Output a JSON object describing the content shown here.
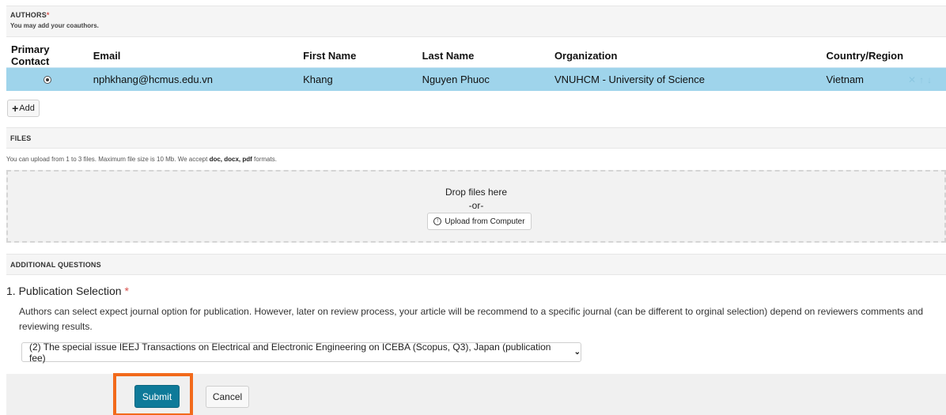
{
  "authors": {
    "title": "AUTHORS",
    "required_mark": "*",
    "subtitle": "You may add your coauthors.",
    "columns": [
      "Primary Contact",
      "Email",
      "First Name",
      "Last Name",
      "Organization",
      "Country/Region"
    ],
    "rows": [
      {
        "email": "nphkhang@hcmus.edu.vn",
        "first_name": "Khang",
        "last_name": "Nguyen Phuoc",
        "organization": "VNUHCM - University of Science",
        "country": "Vietnam"
      }
    ],
    "row_actions": {
      "delete": "✕",
      "up": "↑",
      "down": "↓"
    },
    "add_label": "Add"
  },
  "files": {
    "title": "FILES",
    "note_prefix": "You can upload from 1 to 3 files. Maximum file size is 10 Mb. We accept",
    "note_formats": "doc, docx, pdf",
    "note_suffix": "formats.",
    "drop_text": "Drop files here",
    "or_text": "-or-",
    "upload_label": "Upload from Computer"
  },
  "additional_questions": {
    "title": "ADDITIONAL QUESTIONS",
    "q1_title": "1. Publication Selection",
    "q1_required": "*",
    "q1_description": "Authors can select expect journal option for publication. However, later on review process, your article will be recommend to a specific journal (can be different to orginal selection) depend on reviewers comments and reviewing results.",
    "q1_selected": "(2) The special issue IEEJ Transactions on Electrical and Electronic Engineering on ICEBA (Scopus, Q3), Japan (publication fee)"
  },
  "actions": {
    "submit_label": "Submit",
    "cancel_label": "Cancel"
  },
  "colors": {
    "selected_row": "#9fd4eb",
    "submit": "#0e7a99",
    "highlight": "#f26a1b",
    "required": "#d9534f"
  },
  "icons": [
    "radio-selected-icon",
    "delete-icon",
    "arrow-up-icon",
    "arrow-down-icon",
    "plus-icon",
    "upload-icon",
    "chevron-down-icon"
  ]
}
